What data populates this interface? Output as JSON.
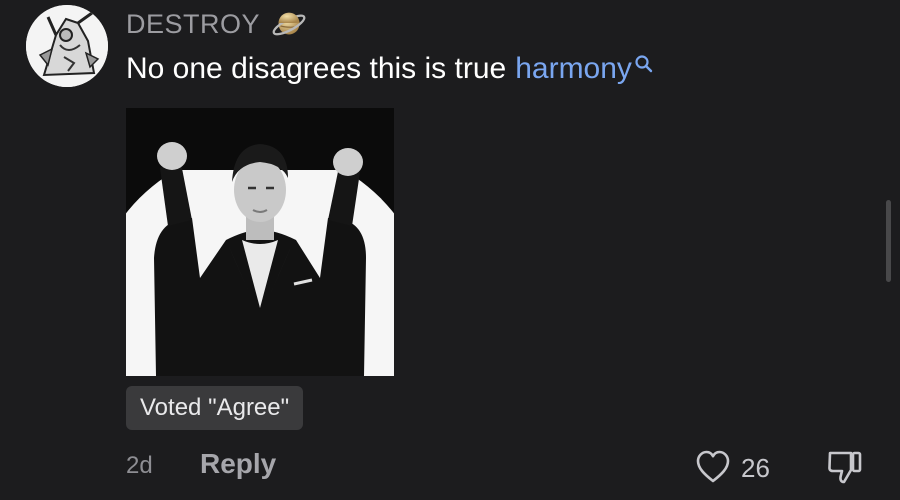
{
  "comment": {
    "username": "DESTROY",
    "text_plain": "No one disagrees this is true",
    "text_link": "harmony",
    "vote_label": "Voted \"Agree\"",
    "time": "2d",
    "reply_label": "Reply",
    "like_count": "26"
  },
  "icons": {
    "username_badge": "planet-icon",
    "link_suffix": "search-icon",
    "like": "heart-outline-icon",
    "dislike": "thumbs-down-outline-icon"
  },
  "colors": {
    "background": "#1c1c1e",
    "link": "#7aa6f0",
    "username": "#9c9ca1",
    "badge_background": "#3a3a3c"
  }
}
